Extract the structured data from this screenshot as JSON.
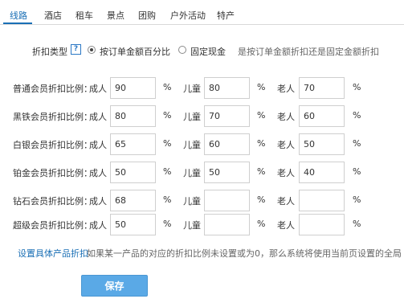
{
  "tabs": [
    "线路",
    "酒店",
    "租车",
    "景点",
    "团购",
    "户外活动",
    "特产"
  ],
  "active_tab": "线路",
  "discount_type": {
    "label": "折扣类型",
    "help": "?",
    "options": [
      "按订单金额百分比",
      "固定现金"
    ],
    "selected": "按订单金额百分比",
    "hint": "是按订单金额折扣还是固定金额折扣"
  },
  "categories": {
    "adult": "成人",
    "child": "儿童",
    "senior": "老人"
  },
  "percent_sign": "%",
  "rows": [
    {
      "label": "普通会员折扣比例：",
      "adult": "90",
      "child": "80",
      "senior": "70"
    },
    {
      "label": "黑铁会员折扣比例：",
      "adult": "80",
      "child": "70",
      "senior": "60"
    },
    {
      "label": "白银会员折扣比例：",
      "adult": "65",
      "child": "60",
      "senior": "50"
    },
    {
      "label": "铂金会员折扣比例：",
      "adult": "50",
      "child": "50",
      "senior": "40"
    },
    {
      "label": "钻石会员折扣比例：",
      "adult": "68",
      "child": "",
      "senior": ""
    },
    {
      "label": "超级会员折扣比例：",
      "adult": "50",
      "child": "",
      "senior": ""
    }
  ],
  "footer": {
    "link": "设置具体产品折扣",
    "note": "如果某一产品的对应的折扣比例未设置或为0，那么系统将使用当前页设置的全局"
  },
  "save_label": "保存"
}
